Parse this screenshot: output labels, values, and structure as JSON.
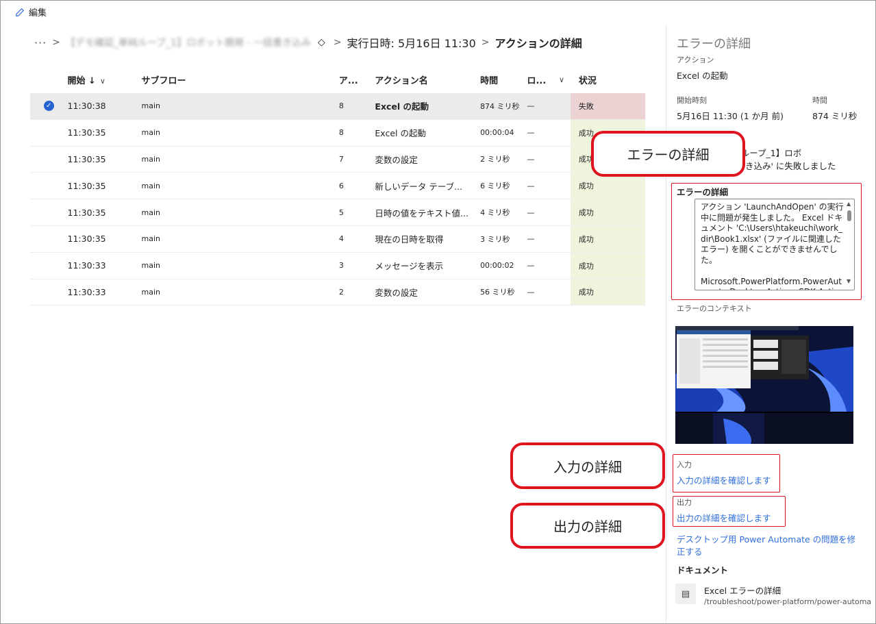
{
  "toolbar": {
    "edit_label": "編集"
  },
  "breadcrumb": {
    "more": "···",
    "flow_name": "【デモ確認_単純ループ_1】ロボット開発 - 一括書き込み",
    "run_time": "実行日時: 5月16日 11:30",
    "current": "アクションの詳細"
  },
  "table": {
    "headers": {
      "start": "開始 ↓",
      "subflow": "サブフロー",
      "action_no": "ア...",
      "action_name": "アクション名",
      "duration": "時間",
      "log": "ロ...",
      "status": "状況"
    },
    "rows": [
      {
        "start": "11:30:38",
        "subflow": "main",
        "action_no": "8",
        "name": "Excel の起動",
        "duration": "874 ミリ秒",
        "log": "—",
        "status": "失敗"
      },
      {
        "start": "11:30:35",
        "subflow": "main",
        "action_no": "8",
        "name": "Excel の起動",
        "duration": "00:00:04",
        "log": "—",
        "status": "成功"
      },
      {
        "start": "11:30:35",
        "subflow": "main",
        "action_no": "7",
        "name": "変数の設定",
        "duration": "2 ミリ秒",
        "log": "—",
        "status": "成功"
      },
      {
        "start": "11:30:35",
        "subflow": "main",
        "action_no": "6",
        "name": "新しいデータ テーブ...",
        "duration": "6 ミリ秒",
        "log": "—",
        "status": "成功"
      },
      {
        "start": "11:30:35",
        "subflow": "main",
        "action_no": "5",
        "name": "日時の値をテキスト値...",
        "duration": "4 ミリ秒",
        "log": "—",
        "status": "成功"
      },
      {
        "start": "11:30:35",
        "subflow": "main",
        "action_no": "4",
        "name": "現在の日時を取得",
        "duration": "3 ミリ秒",
        "log": "—",
        "status": "成功"
      },
      {
        "start": "11:30:33",
        "subflow": "main",
        "action_no": "3",
        "name": "メッセージを表示",
        "duration": "00:00:02",
        "log": "—",
        "status": "成功"
      },
      {
        "start": "11:30:33",
        "subflow": "main",
        "action_no": "2",
        "name": "変数の設定",
        "duration": "56 ミリ秒",
        "log": "—",
        "status": "成功"
      }
    ]
  },
  "panel": {
    "title": "エラーの詳細",
    "action_label": "アクション",
    "action_value": "Excel の起動",
    "start_label": "開始時刻",
    "start_value": "5月16日 11:30 (1 か月 前)",
    "duration_label": "時間",
    "duration_value": "874 ミリ秒",
    "message_line1": "【デモ確認_単純ループ_1】ロボ",
    "message_line2": "ット開発 - 一括書き込み' に失敗しました",
    "error_details_label": "エラーの詳細",
    "error_text": "アクション 'LaunchAndOpen' の実行中に問題が発生しました。 Excel ドキュメント 'C:\\Users\\htakeuchi\\work_dir\\Book1.xlsx' (ファイルに関連したエラー) を開くことができませんでした。\n\nMicrosoft.PowerPlatform.PowerAutomate.Desktop.Actions.SDK.ActionException",
    "context_label": "エラーのコンテキスト",
    "input_label": "入力",
    "input_link": "入力の詳細を確認します",
    "output_label": "出力",
    "output_link": "出力の詳細を確認します",
    "fix_link": "デスクトップ用 Power Automate の問題を修正する",
    "docs_label": "ドキュメント",
    "doc_title": "Excel エラーの詳細",
    "doc_url": "/troubleshoot/power-platform/power-automa"
  },
  "callouts": {
    "error": "エラーの詳細",
    "input": "入力の詳細",
    "output": "出力の詳細"
  },
  "colors": {
    "accent": "#2563d0",
    "link": "#2f6fdd",
    "fail_bg": "#ecd3d3",
    "success_bg": "#eef5dc",
    "annotation": "#e0141e"
  }
}
